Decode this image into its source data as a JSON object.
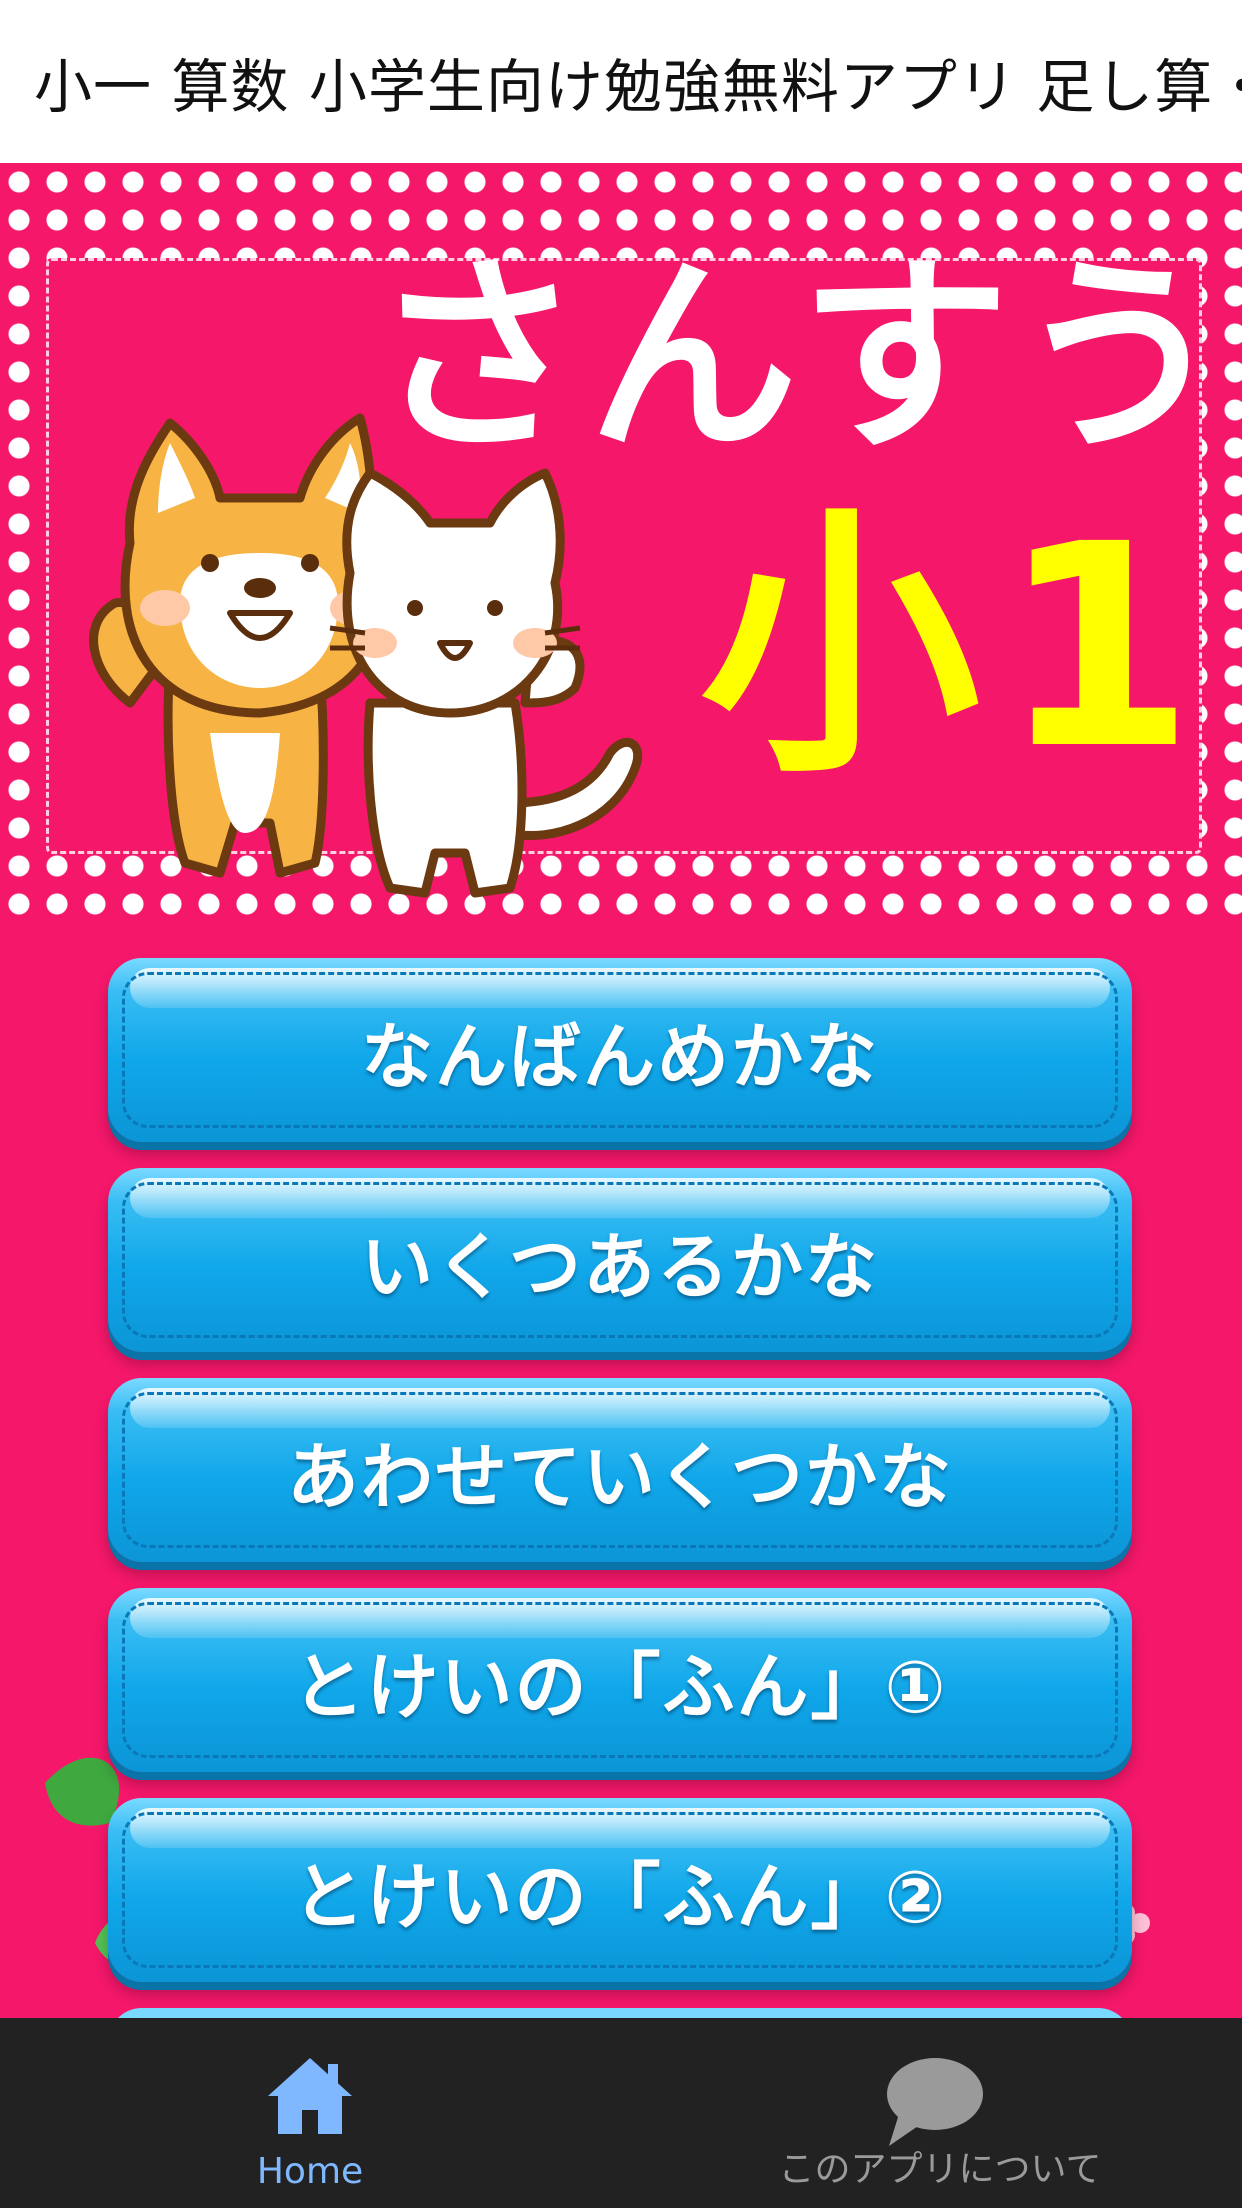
{
  "app": {
    "title": "小一 算数 小学生向け勉強無料アプリ 足し算・"
  },
  "hero": {
    "heading": "さんすう",
    "grade": "小1"
  },
  "menu": {
    "items": [
      {
        "label": "なんばんめかな"
      },
      {
        "label": "いくつあるかな"
      },
      {
        "label": "あわせていくつかな"
      },
      {
        "label": "とけいの「ふん」①"
      },
      {
        "label": "とけいの「ふん」②"
      }
    ]
  },
  "tabbar": {
    "home_label": "Home",
    "about_label": "このアプリについて",
    "active_color": "#7fb8ff",
    "inactive_color": "#9a9a9a",
    "home_icon": "home-icon",
    "about_icon": "speech-bubble-icon"
  },
  "colors": {
    "background_pink": "#f5176a",
    "heading_white": "#ffffff",
    "grade_yellow": "#ffff00",
    "button_blue": "#10a7ea"
  }
}
